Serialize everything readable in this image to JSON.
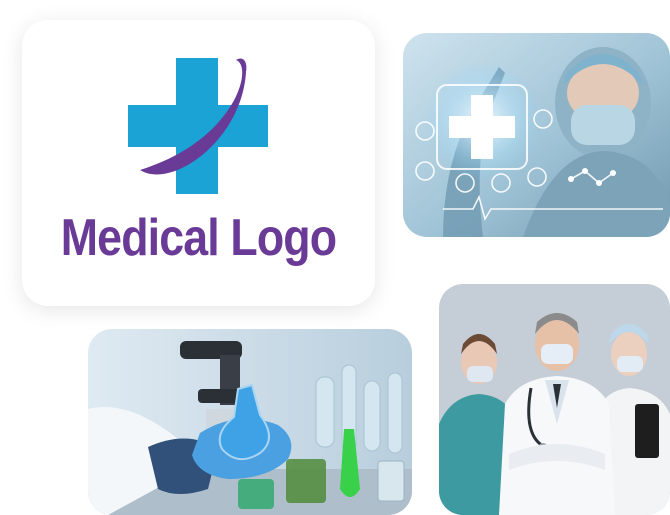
{
  "logo_card": {
    "title": "Medical Logo",
    "icon": "medical-cross-swoosh-icon",
    "colors": {
      "cross": "#1aa3d4",
      "swoosh": "#6a3a97",
      "text": "#6a3a97"
    }
  },
  "photos": [
    {
      "name": "doctor-with-digital-cross-photo",
      "icon": "medical-cross-icon"
    },
    {
      "name": "laboratory-flask-photo",
      "icon": "flask-icon"
    },
    {
      "name": "medical-staff-photo",
      "icon": "doctor-icon"
    }
  ]
}
